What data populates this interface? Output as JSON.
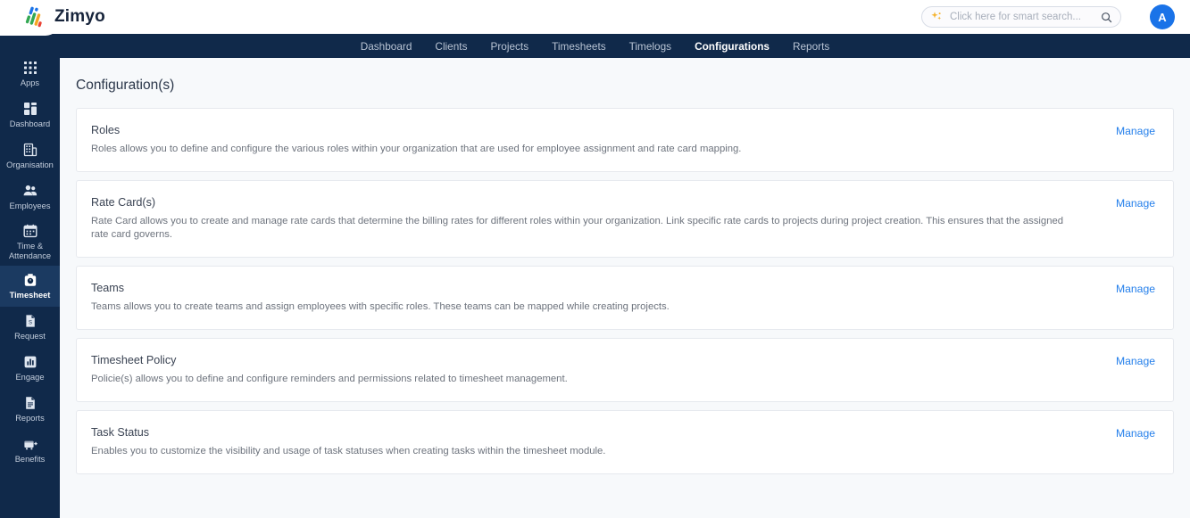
{
  "header": {
    "brand_name": "Zimyo",
    "logo_icon": "zimyo-slashes-logo",
    "search": {
      "placeholder": "Click here for smart search...",
      "value": "",
      "sparkle_icon": "sparkle-icon",
      "magnifier_icon": "search-icon"
    },
    "avatar_initial": "A"
  },
  "topnav": {
    "items": [
      {
        "label": "Dashboard",
        "active": false
      },
      {
        "label": "Clients",
        "active": false
      },
      {
        "label": "Projects",
        "active": false
      },
      {
        "label": "Timesheets",
        "active": false
      },
      {
        "label": "Timelogs",
        "active": false
      },
      {
        "label": "Configurations",
        "active": true
      },
      {
        "label": "Reports",
        "active": false
      }
    ]
  },
  "sidebar": {
    "items": [
      {
        "label": "Apps",
        "icon": "grid-dots-icon",
        "active": false
      },
      {
        "label": "Dashboard",
        "icon": "dashboard-squares-icon",
        "active": false
      },
      {
        "label": "Organisation",
        "icon": "building-icon",
        "active": false
      },
      {
        "label": "Employees",
        "icon": "people-icon",
        "active": false
      },
      {
        "label": "Time & Attendance",
        "icon": "calendar-icon",
        "active": false
      },
      {
        "label": "Timesheet",
        "icon": "timesheet-clock-icon",
        "active": true
      },
      {
        "label": "Request",
        "icon": "document-request-icon",
        "active": false
      },
      {
        "label": "Engage",
        "icon": "bar-chart-icon",
        "active": false
      },
      {
        "label": "Reports",
        "icon": "report-document-icon",
        "active": false
      },
      {
        "label": "Benefits",
        "icon": "benefits-cart-icon",
        "active": false
      }
    ]
  },
  "main": {
    "page_title": "Configuration(s)",
    "manage_label": "Manage",
    "cards": [
      {
        "title": "Roles",
        "description": "Roles allows you to define and configure the various roles within your organization that are used for employee assignment and rate card mapping."
      },
      {
        "title": "Rate Card(s)",
        "description": "Rate Card allows you to create and manage rate cards that determine the billing rates for different roles within your organization. Link specific rate cards to projects during project creation. This ensures that the assigned rate card governs."
      },
      {
        "title": "Teams",
        "description": "Teams allows you to create teams and assign employees with specific roles. These teams can be mapped while creating projects."
      },
      {
        "title": "Timesheet Policy",
        "description": "Policie(s) allows you to define and configure reminders and permissions related to timesheet management."
      },
      {
        "title": "Task Status",
        "description": "Enables you to customize the visibility and usage of task statuses when creating tasks within the timesheet module."
      }
    ]
  },
  "colors": {
    "nav_dark": "#10294a",
    "accent_link": "#2680eb",
    "avatar_blue": "#1a73e8",
    "page_bg": "#f7f9fb"
  }
}
